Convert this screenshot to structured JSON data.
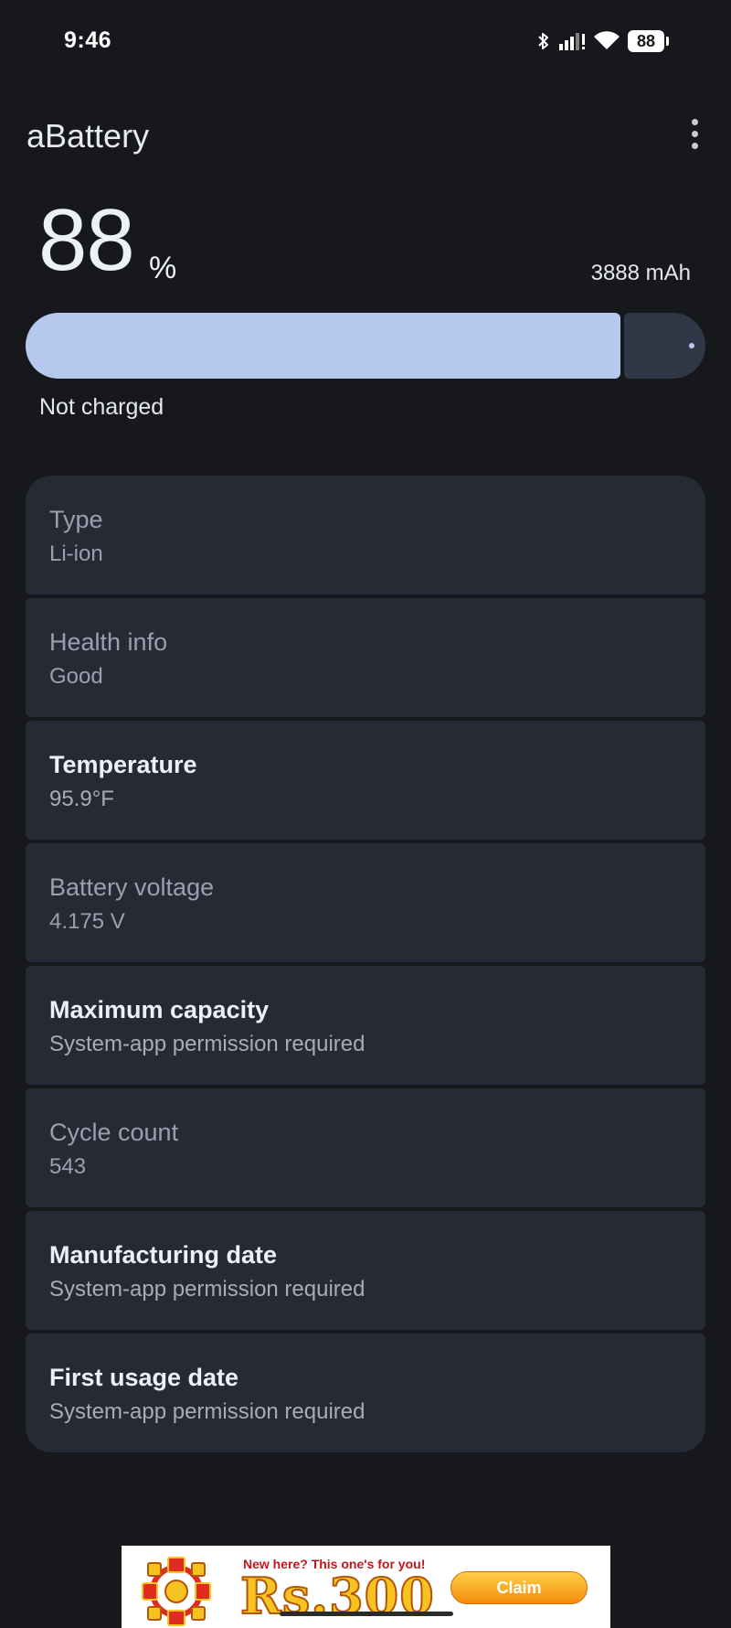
{
  "status_bar": {
    "time": "9:46",
    "battery_level": "88",
    "icons": [
      "bluetooth-icon",
      "signal-icon",
      "wifi-icon",
      "battery-icon"
    ]
  },
  "app_bar": {
    "title": "aBattery",
    "menu_icon": "more-vert-icon"
  },
  "battery": {
    "percent": "88",
    "percent_sign": "%",
    "level_fraction": 0.88,
    "capacity": "3888 mAh",
    "status": "Not charged",
    "colors": {
      "fill": "#b6c8ee",
      "track": "#303747"
    }
  },
  "info": [
    {
      "label": "Type",
      "value": "Li-ion",
      "emphasis": false
    },
    {
      "label": "Health info",
      "value": "Good",
      "emphasis": false
    },
    {
      "label": "Temperature",
      "value": "95.9°F",
      "emphasis": true
    },
    {
      "label": "Battery voltage",
      "value": "4.175 V",
      "emphasis": false
    },
    {
      "label": "Maximum capacity",
      "value": "System-app permission required",
      "emphasis": true
    },
    {
      "label": "Cycle count",
      "value": "543",
      "emphasis": false
    },
    {
      "label": "Manufacturing date",
      "value": "System-app permission required",
      "emphasis": true
    },
    {
      "label": "First usage date",
      "value": "System-app permission required",
      "emphasis": true
    }
  ],
  "ad": {
    "headline": "New here? This one's for you!",
    "amount": "Rs.300",
    "cta": "Claim"
  }
}
